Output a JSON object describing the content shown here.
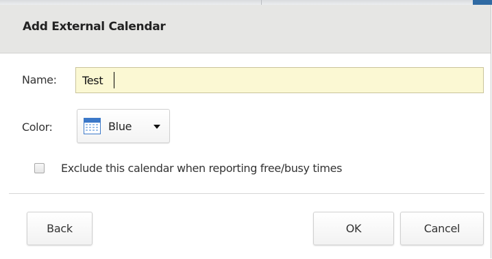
{
  "dialog": {
    "title": "Add External Calendar",
    "name_label": "Name:",
    "name_value": "Test",
    "color_label": "Color:",
    "color_value": "Blue",
    "color_icon": "calendar-icon",
    "exclude_checked": false,
    "exclude_label": "Exclude this calendar when reporting free/busy times",
    "buttons": {
      "back": "Back",
      "ok": "OK",
      "cancel": "Cancel"
    }
  },
  "colors": {
    "header_bg": "#e6e6e4",
    "input_bg": "#fbf8d3",
    "calendar_icon_blue": "#3b78c8",
    "top_edge_blue": "#2f6aa3"
  }
}
